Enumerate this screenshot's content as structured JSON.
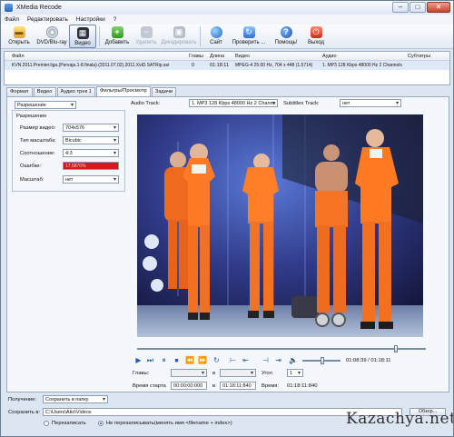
{
  "window": {
    "title": "XMedia Recode",
    "min": "–",
    "max": "□",
    "close": "✕"
  },
  "menu": [
    "Файл",
    "Редактировать",
    "Настройки",
    "?"
  ],
  "toolbar": {
    "open": "Открыть",
    "dvd": "DVD/Blu-ray",
    "video": "Видео",
    "add": "Добавить",
    "delete": "Удалить",
    "decode": "Декодировать",
    "site": "Сайт",
    "check": "Проверить ...",
    "help": "Помощь!",
    "exit": "Выход"
  },
  "filelist": {
    "headers": {
      "file": "Файл",
      "chapters": "Главы",
      "length": "Длина",
      "video": "Видео",
      "audio": "Аудио",
      "subtitles": "Субтитры"
    },
    "row": {
      "file": "KVN.2011.Premier.liga.(Pervaja.1-8.finala).(2011.07.02).2011.XviD.SATRip.avi",
      "chapters": "0",
      "length": "01:18:11",
      "video": "MPEG-4 25.00 Hz, 704 x 448 (1.5714)",
      "audio": "1. MP3 128 Kbps 48000 Hz 2 Channels"
    }
  },
  "tabs": [
    "Формат",
    "Видео",
    "Аудио трек 1",
    "Фильтры/Просмотр",
    "Задачи"
  ],
  "active_tab": "Фильтры/Просмотр",
  "filters": {
    "filter_select": "Разрешение",
    "group_title": "Разрешение",
    "size_label": "Размер видео:",
    "size_value": "704x576",
    "scale_type_label": "Тип масштаба:",
    "scale_type_value": "Bicubic",
    "ratio_label": "Соотношение:",
    "ratio_value": "4:3",
    "errors_label": "Ошибки:",
    "errors_value": "17,5870%",
    "scale_label": "Масштаб:",
    "scale_value": "нет"
  },
  "tracks": {
    "audio_label": "Audio Track:",
    "audio_value": "1. MP3 128 Kbps 48000 Hz 2 Channe",
    "subs_label": "Subtitles Track:",
    "subs_value": "нет"
  },
  "playback": {
    "position": 0.9,
    "time": "01:08:39 / 01:18:11",
    "chapters_label": "Главы:",
    "in_label": "в",
    "angle_label": "Угол",
    "angle_value": "1",
    "start_label": "Время старта",
    "start_value": "00:00:00:000",
    "end_value": "01:18:11:840",
    "duration_label": "Время:",
    "duration_value": "01:18:11:840"
  },
  "bottom": {
    "receiver_label": "Получение:",
    "receiver_value": "Сохранить в папку",
    "save_label": "Сохранить в:",
    "save_path": "C:\\Users\\Ako\\Videos",
    "browse": "Обзор...",
    "overwrite": "Перезаписать",
    "no_overwrite": "Не перезаписывать(менять имя <filename + index>)"
  },
  "watermark": "Kazachya.net",
  "colors": {
    "accent": "#2a5aa8",
    "error": "#d21a1a"
  }
}
